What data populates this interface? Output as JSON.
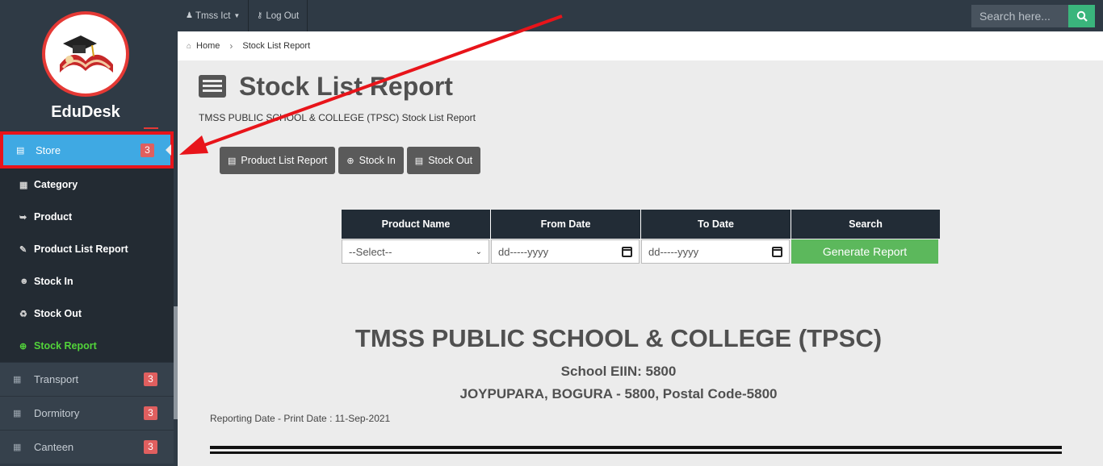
{
  "sidebar": {
    "brand": "EduDesk",
    "store": {
      "label": "Store",
      "badge": "3"
    },
    "submenu": [
      {
        "label": "Category",
        "icon": "grid-icon"
      },
      {
        "label": "Product",
        "icon": "product-icon"
      },
      {
        "label": "Product List Report",
        "icon": "book-edit-icon"
      },
      {
        "label": "Stock In",
        "icon": "user-plus-icon"
      },
      {
        "label": "Stock Out",
        "icon": "recycle-icon"
      },
      {
        "label": "Stock Report",
        "icon": "plus-circle-icon"
      }
    ],
    "items": [
      {
        "label": "Transport",
        "badge": "3"
      },
      {
        "label": "Dormitory",
        "badge": "3"
      },
      {
        "label": "Canteen",
        "badge": "3"
      }
    ]
  },
  "topbar": {
    "user": "Tmss Ict",
    "logout": "Log Out",
    "search_placeholder": "Search here..."
  },
  "breadcrumb": {
    "home": "Home",
    "current": "Stock List Report"
  },
  "page": {
    "title": "Stock List Report",
    "subtitle": "TMSS PUBLIC SCHOOL & COLLEGE (TPSC) Stock List Report",
    "buttons": {
      "product_list": "Product List Report",
      "stock_in": "Stock In",
      "stock_out": "Stock Out"
    }
  },
  "filter": {
    "headers": {
      "product": "Product Name",
      "from": "From Date",
      "to": "To Date",
      "search": "Search"
    },
    "product_value": "--Select--",
    "from_value": "dd-----yyyy",
    "to_value": "dd-----yyyy",
    "generate": "Generate Report"
  },
  "report": {
    "school": "TMSS PUBLIC SCHOOL & COLLEGE (TPSC)",
    "eiin": "School EIIN: 5800",
    "address": "JOYPUPARA, BOGURA - 5800, Postal Code-5800",
    "date": "Reporting Date - Print Date : 11-Sep-2021"
  },
  "colors": {
    "accent": "#3fa9e3",
    "badge": "#e05f5f",
    "generate": "#5cb85c",
    "annotation": "#e8141a"
  }
}
